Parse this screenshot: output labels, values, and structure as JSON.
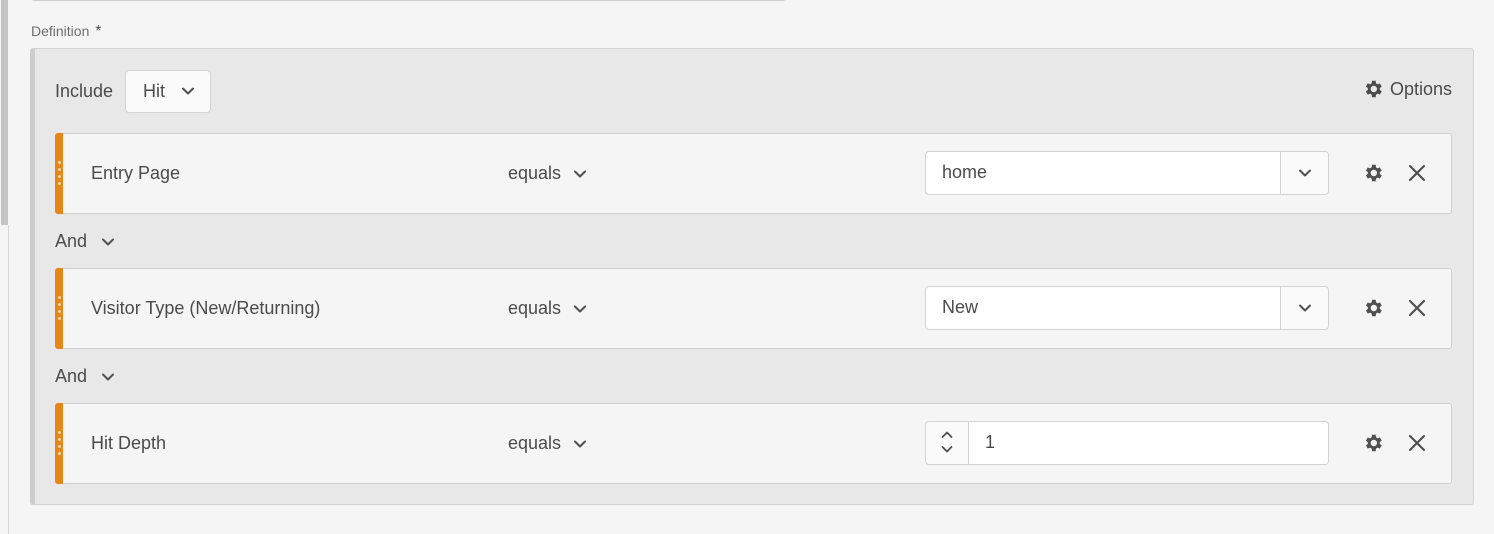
{
  "definition": {
    "label": "Definition",
    "required_mark": "*"
  },
  "container": {
    "include_label": "Include",
    "include_value": "Hit",
    "options_label": "Options"
  },
  "rules": [
    {
      "name": "Entry Page",
      "operator": "equals",
      "value": "home",
      "input_type": "combobox"
    },
    {
      "name": "Visitor Type (New/Returning)",
      "operator": "equals",
      "value": "New",
      "input_type": "combobox"
    },
    {
      "name": "Hit Depth",
      "operator": "equals",
      "value": "1",
      "input_type": "stepper"
    }
  ],
  "connectors": [
    "And",
    "And"
  ],
  "colors": {
    "accent": "#e68619",
    "container_bg": "#e8e8e8",
    "rule_bg": "#f5f5f5",
    "text": "#4b4b4b"
  },
  "icons": {
    "gear": "gear-icon",
    "close": "close-icon",
    "chevron": "chevron-down-icon",
    "stepper": "stepper-arrows-icon"
  }
}
